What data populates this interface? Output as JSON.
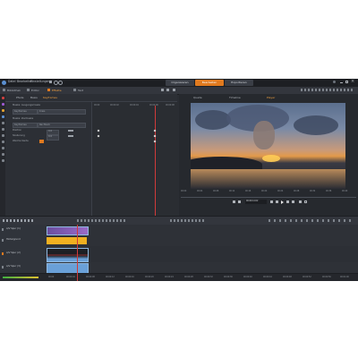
{
  "app": {
    "menu": [
      "Datei",
      "Bearbeiten",
      "Einstellungen"
    ],
    "mode_buttons": [
      {
        "label": "Organisieren",
        "active": false
      },
      {
        "label": "Bearbeiten",
        "active": true
      },
      {
        "label": "Exportieren",
        "active": false
      }
    ]
  },
  "top_tabs": [
    "Bibliothek",
    "Editor",
    "Effekte",
    "Text"
  ],
  "editor_panel": {
    "tabs": [
      {
        "label": "Pfade",
        "active": false
      },
      {
        "label": "Basis",
        "active": false
      },
      {
        "label": "Keyframes",
        "active": true
      }
    ],
    "section1_label": "Maske: Ausgangsmaske",
    "dd1a": "Keyframes",
    "dd1b": "Kreis",
    "section2_label": "Maske: Zielmaske",
    "dd2a": "Keyframes",
    "dd2b": "Rechteck",
    "param1_label": "Position",
    "param1_value": "0.0",
    "param2_label": "Skalierung",
    "param2_value": "0.0",
    "param3_label": "Weiche Kante",
    "timeline_labels": [
      "00:00",
      "00:00:02",
      "00:00:04",
      "00:00:06",
      "00:00:08"
    ]
  },
  "preview": {
    "tabs": [
      {
        "label": "Quelle",
        "active": false
      },
      {
        "label": "Timeline",
        "active": false
      },
      {
        "label": "Player",
        "active": true
      }
    ],
    "timecode": "00:00:14:02",
    "ruler_labels": [
      "00:00",
      "00:04",
      "00:08",
      "00:12",
      "00:16",
      "00:20",
      "00:24",
      "00:28",
      "00:32",
      "00:36",
      "00:40"
    ]
  },
  "timeline": {
    "tracks": [
      {
        "name": "A/V Spur (1)"
      },
      {
        "name": "Hintergrund"
      },
      {
        "name": "A/V Spur (2)"
      },
      {
        "name": "A/V Spur (3)"
      },
      {
        "name": "A/V Spur (4)"
      }
    ],
    "ruler_labels": [
      "00:00",
      "00:00:04",
      "00:00:08",
      "00:00:12",
      "00:00:16",
      "00:00:20",
      "00:00:24",
      "00:00:28",
      "00:00:32",
      "00:00:36",
      "00:00:40",
      "00:00:44",
      "00:00:48",
      "00:00:52",
      "00:00:56",
      "00:01:00"
    ]
  },
  "colors": {
    "accent": "#e07a1f",
    "background": "#2a2d33",
    "clip_orange": "#f0b020",
    "clip_blue": "#6aa0d8"
  }
}
